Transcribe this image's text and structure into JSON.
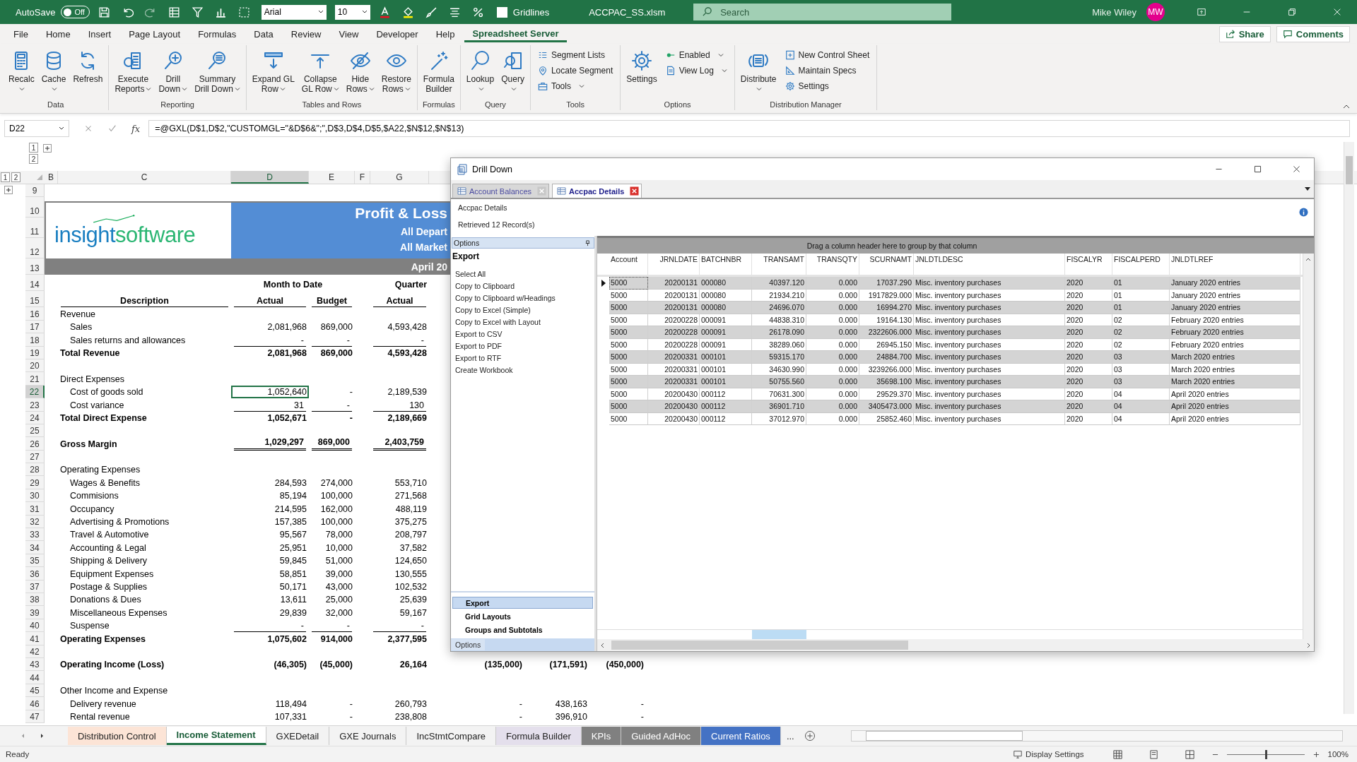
{
  "title_bar": {
    "autosave_label": "AutoSave",
    "autosave_on": false,
    "autosave_state": "Off",
    "font_name": "Arial",
    "font_size": "10",
    "gridlines_label": "Gridlines",
    "gridlines_checked": false,
    "file_name": "ACCPAC_SS.xlsm",
    "search_placeholder": "Search",
    "user_name": "Mike Wiley",
    "user_initials": "MW"
  },
  "ribbon_tabs": [
    {
      "label": "File",
      "selected": false
    },
    {
      "label": "Home",
      "selected": false
    },
    {
      "label": "Insert",
      "selected": false
    },
    {
      "label": "Page Layout",
      "selected": false
    },
    {
      "label": "Formulas",
      "selected": false
    },
    {
      "label": "Data",
      "selected": false
    },
    {
      "label": "Review",
      "selected": false
    },
    {
      "label": "View",
      "selected": false
    },
    {
      "label": "Developer",
      "selected": false
    },
    {
      "label": "Help",
      "selected": false
    },
    {
      "label": "Spreadsheet Server",
      "selected": true
    }
  ],
  "share_button": "Share",
  "comments_button": "Comments",
  "ribbon_groups": [
    {
      "label": "Data",
      "items": [
        {
          "kind": "large",
          "lines": [
            "Recalc"
          ],
          "dropdown": true
        },
        {
          "kind": "large",
          "lines": [
            "Cache"
          ],
          "dropdown": true
        },
        {
          "kind": "large",
          "lines": [
            "Refresh"
          ],
          "dropdown": false
        }
      ]
    },
    {
      "label": "Reporting",
      "items": [
        {
          "kind": "large",
          "lines": [
            "Execute",
            "Reports"
          ],
          "dropdown": true
        },
        {
          "kind": "large",
          "lines": [
            "Drill",
            "Down"
          ],
          "dropdown": true
        },
        {
          "kind": "large",
          "lines": [
            "Summary",
            "Drill Down"
          ],
          "dropdown": true
        }
      ]
    },
    {
      "label": "Tables and Rows",
      "items": [
        {
          "kind": "large",
          "lines": [
            "Expand GL",
            "Row"
          ],
          "dropdown": true
        },
        {
          "kind": "large",
          "lines": [
            "Collapse",
            "GL Row"
          ],
          "dropdown": true
        },
        {
          "kind": "large",
          "lines": [
            "Hide",
            "Rows"
          ],
          "dropdown": true
        },
        {
          "kind": "large",
          "lines": [
            "Restore",
            "Rows"
          ],
          "dropdown": true
        }
      ]
    },
    {
      "label": "Formulas",
      "items": [
        {
          "kind": "large",
          "lines": [
            "Formula",
            "Builder"
          ],
          "dropdown": false
        }
      ]
    },
    {
      "label": "Query",
      "items": [
        {
          "kind": "large",
          "lines": [
            "Lookup"
          ],
          "dropdown": true
        },
        {
          "kind": "large",
          "lines": [
            "Query"
          ],
          "dropdown": true
        }
      ]
    },
    {
      "label": "Tools",
      "items": [
        {
          "kind": "small",
          "label": "Segment Lists",
          "dropdown": false
        },
        {
          "kind": "small",
          "label": "Locate Segment",
          "dropdown": false
        },
        {
          "kind": "small",
          "label": "Tools",
          "dropdown": true
        }
      ]
    },
    {
      "label": "Options",
      "items": [
        {
          "kind": "large",
          "lines": [
            "Settings"
          ],
          "dropdown": false
        },
        {
          "kind": "small",
          "label": "Enabled",
          "dropdown": true
        },
        {
          "kind": "small",
          "label": "View Log",
          "dropdown": true
        }
      ]
    },
    {
      "label": "Distribution Manager",
      "items": [
        {
          "kind": "large",
          "lines": [
            "Distribute"
          ],
          "dropdown": true
        },
        {
          "kind": "small",
          "label": "New Control Sheet",
          "dropdown": false
        },
        {
          "kind": "small",
          "label": "Maintain Specs",
          "dropdown": false
        },
        {
          "kind": "small",
          "label": "Settings",
          "dropdown": false
        }
      ]
    }
  ],
  "formula_bar": {
    "name_box": "D22",
    "fx": "fx",
    "formula": "=@GXL(D$1,D$2,\"CUSTOMGL=\"&D$6&\";\",D$3,D$4,D$5,$A22,$N$12,$N$13)"
  },
  "sheet": {
    "column_levels": [
      "1",
      "2"
    ],
    "row_levels": [
      "1",
      "2"
    ],
    "columns": [
      {
        "label": "B",
        "selected": false
      },
      {
        "label": "C",
        "selected": false
      },
      {
        "label": "D",
        "selected": true
      },
      {
        "label": "E",
        "selected": false
      },
      {
        "label": "F",
        "selected": false
      },
      {
        "label": "G",
        "selected": false
      }
    ],
    "banner": {
      "logo": [
        "insight",
        "software"
      ],
      "title": "Profit & Loss",
      "lines": [
        "All Depart",
        "All Market"
      ],
      "bar": "April 20"
    },
    "rows": [
      {
        "n": "9",
        "kind": "blank",
        "selected": false
      },
      {
        "n": "10",
        "kind": "banner",
        "selected": false
      },
      {
        "n": "11",
        "kind": "banner",
        "selected": false
      },
      {
        "n": "12",
        "kind": "banner",
        "selected": false
      },
      {
        "n": "13",
        "kind": "banner_bar",
        "selected": false
      },
      {
        "n": "14",
        "kind": "group",
        "d": "Month to Date",
        "g": "Quarter",
        "selected": false
      },
      {
        "n": "15",
        "kind": "header",
        "c": "Description",
        "d": "Actual",
        "e": "Budget",
        "g": "Actual",
        "selected": false
      },
      {
        "n": "16",
        "kind": "label",
        "c": "Revenue",
        "selected": false
      },
      {
        "n": "17",
        "kind": "item",
        "c": "Sales",
        "d": "2,081,968",
        "e": "869,000",
        "g": "4,593,428",
        "selected": false
      },
      {
        "n": "18",
        "kind": "item",
        "c": "Sales returns and allowances",
        "d": "-",
        "e": "-",
        "g": "-",
        "underline": true,
        "selected": false
      },
      {
        "n": "19",
        "kind": "total",
        "c": "Total Revenue",
        "d": "2,081,968",
        "e": "869,000",
        "g": "4,593,428",
        "selected": false
      },
      {
        "n": "20",
        "kind": "blank",
        "selected": false
      },
      {
        "n": "21",
        "kind": "label",
        "c": "Direct Expenses",
        "selected": false
      },
      {
        "n": "22",
        "kind": "item",
        "c": "Cost of goods sold",
        "d": "1,052,640",
        "e": "-",
        "g": "2,189,539",
        "selected": true
      },
      {
        "n": "23",
        "kind": "item",
        "c": "Cost variance",
        "d": "31",
        "e": "-",
        "g": "130",
        "underline": true,
        "selected": false
      },
      {
        "n": "24",
        "kind": "total",
        "c": "Total Direct Expense",
        "d": "1,052,671",
        "e": "-",
        "g": "2,189,669",
        "selected": false
      },
      {
        "n": "25",
        "kind": "blank",
        "selected": false
      },
      {
        "n": "26",
        "kind": "total",
        "c": "Gross Margin",
        "d": "1,029,297",
        "e": "869,000",
        "g": "2,403,759",
        "double_underline": true,
        "selected": false
      },
      {
        "n": "27",
        "kind": "blank",
        "selected": false
      },
      {
        "n": "28",
        "kind": "label",
        "c": "Operating Expenses",
        "selected": false
      },
      {
        "n": "29",
        "kind": "item",
        "c": "Wages & Benefits",
        "d": "284,593",
        "e": "274,000",
        "g": "553,710",
        "selected": false
      },
      {
        "n": "30",
        "kind": "item",
        "c": "Commisions",
        "d": "85,194",
        "e": "100,000",
        "g": "271,568",
        "selected": false
      },
      {
        "n": "31",
        "kind": "item",
        "c": "Occupancy",
        "d": "214,595",
        "e": "162,000",
        "g": "488,119",
        "selected": false
      },
      {
        "n": "32",
        "kind": "item",
        "c": "Advertising & Promotions",
        "d": "157,385",
        "e": "100,000",
        "g": "375,275",
        "selected": false
      },
      {
        "n": "33",
        "kind": "item",
        "c": "Travel & Automotive",
        "d": "95,567",
        "e": "78,000",
        "g": "208,797",
        "selected": false
      },
      {
        "n": "34",
        "kind": "item",
        "c": "Accounting & Legal",
        "d": "25,951",
        "e": "10,000",
        "g": "37,582",
        "selected": false
      },
      {
        "n": "35",
        "kind": "item",
        "c": "Shipping & Delivery",
        "d": "59,845",
        "e": "51,000",
        "g": "124,650",
        "selected": false
      },
      {
        "n": "36",
        "kind": "item",
        "c": "Equipment Expenses",
        "d": "58,851",
        "e": "39,000",
        "g": "130,555",
        "selected": false
      },
      {
        "n": "37",
        "kind": "item",
        "c": "Postage & Supplies",
        "d": "50,171",
        "e": "43,000",
        "g": "102,532",
        "selected": false
      },
      {
        "n": "38",
        "kind": "item",
        "c": "Donations & Dues",
        "d": "13,611",
        "e": "25,000",
        "g": "25,639",
        "selected": false
      },
      {
        "n": "39",
        "kind": "item",
        "c": "Miscellaneous Expenses",
        "d": "29,839",
        "e": "32,000",
        "g": "59,167",
        "selected": false
      },
      {
        "n": "40",
        "kind": "item",
        "c": "Suspense",
        "d": "-",
        "e": "-",
        "g": "-",
        "underline": true,
        "selected": false
      },
      {
        "n": "41",
        "kind": "total",
        "c": "Operating Expenses",
        "d": "1,075,602",
        "e": "914,000",
        "g": "2,377,595",
        "selected": false
      },
      {
        "n": "42",
        "kind": "blank",
        "selected": false
      },
      {
        "n": "43",
        "kind": "total",
        "c": "Operating Income (Loss)",
        "d": "(46,305)",
        "e": "(45,000)",
        "g": "26,164",
        "h": "(135,000)",
        "i": "(171,591)",
        "j": "(450,000)",
        "selected": false
      },
      {
        "n": "44",
        "kind": "blank",
        "selected": false
      },
      {
        "n": "45",
        "kind": "label",
        "c": "Other Income and Expense",
        "selected": false
      },
      {
        "n": "46",
        "kind": "item",
        "c": "Delivery revenue",
        "d": "118,494",
        "e": "-",
        "g": "260,793",
        "h": "-",
        "i": "438,163",
        "j": "-",
        "selected": false
      },
      {
        "n": "47",
        "kind": "item",
        "c": "Rental revenue",
        "d": "107,331",
        "e": "-",
        "g": "238,808",
        "h": "-",
        "i": "396,910",
        "j": "-",
        "selected": false
      }
    ]
  },
  "drill_down": {
    "title": "Drill Down",
    "tabs": [
      {
        "label": "Account Balances",
        "selected": false
      },
      {
        "label": "Accpac Details",
        "selected": true
      }
    ],
    "heading": "Accpac Details",
    "status": "Retrieved 12 Record(s)",
    "options": {
      "header": "Options",
      "section": "Export",
      "items": [
        "Select All",
        "Copy to Clipboard",
        "Copy to Clipboard w/Headings",
        "Copy to Excel (Simple)",
        "Copy to Excel with Layout",
        "Export to CSV",
        "Export to PDF",
        "Export to RTF",
        "Create Workbook"
      ],
      "nav": [
        {
          "label": "Export",
          "selected": true
        },
        {
          "label": "Grid Layouts",
          "selected": false
        },
        {
          "label": "Groups and Subtotals",
          "selected": false
        }
      ],
      "footer": "Options"
    },
    "grid": {
      "group_hint": "Drag a column header here to group by that column",
      "columns": [
        "Account",
        "JRNLDATE",
        "BATCHNBR",
        "TRANSAMT",
        "TRANSQTY",
        "SCURNAMT",
        "JNLDTLDESC",
        "FISCALYR",
        "FISCALPERD",
        "JNLDTLREF"
      ],
      "rows": [
        {
          "current": true,
          "cells": [
            "5000",
            "20200131",
            "000080",
            "40397.120",
            "0.000",
            "17037.290",
            "Misc. inventory purchases",
            "2020",
            "01",
            "January 2020 entries"
          ]
        },
        {
          "current": false,
          "cells": [
            "5000",
            "20200131",
            "000080",
            "21934.210",
            "0.000",
            "1917829.000",
            "Misc. inventory purchases",
            "2020",
            "01",
            "January 2020 entries"
          ]
        },
        {
          "current": false,
          "cells": [
            "5000",
            "20200131",
            "000080",
            "24696.070",
            "0.000",
            "16994.270",
            "Misc. inventory purchases",
            "2020",
            "01",
            "January 2020 entries"
          ]
        },
        {
          "current": false,
          "cells": [
            "5000",
            "20200228",
            "000091",
            "44838.310",
            "0.000",
            "19164.130",
            "Misc. inventory purchases",
            "2020",
            "02",
            "February 2020 entries"
          ]
        },
        {
          "current": false,
          "cells": [
            "5000",
            "20200228",
            "000091",
            "26178.090",
            "0.000",
            "2322606.000",
            "Misc. inventory purchases",
            "2020",
            "02",
            "February 2020 entries"
          ]
        },
        {
          "current": false,
          "cells": [
            "5000",
            "20200228",
            "000091",
            "38289.060",
            "0.000",
            "26945.150",
            "Misc. inventory purchases",
            "2020",
            "02",
            "February 2020 entries"
          ]
        },
        {
          "current": false,
          "cells": [
            "5000",
            "20200331",
            "000101",
            "59315.170",
            "0.000",
            "24884.700",
            "Misc. inventory purchases",
            "2020",
            "03",
            "March 2020 entries"
          ]
        },
        {
          "current": false,
          "cells": [
            "5000",
            "20200331",
            "000101",
            "34630.990",
            "0.000",
            "3239266.000",
            "Misc. inventory purchases",
            "2020",
            "03",
            "March 2020 entries"
          ]
        },
        {
          "current": false,
          "cells": [
            "5000",
            "20200331",
            "000101",
            "50755.560",
            "0.000",
            "35698.100",
            "Misc. inventory purchases",
            "2020",
            "03",
            "March 2020 entries"
          ]
        },
        {
          "current": false,
          "cells": [
            "5000",
            "20200430",
            "000112",
            "70631.300",
            "0.000",
            "29529.370",
            "Misc. inventory purchases",
            "2020",
            "04",
            "April 2020 entries"
          ]
        },
        {
          "current": false,
          "cells": [
            "5000",
            "20200430",
            "000112",
            "36901.710",
            "0.000",
            "3405473.000",
            "Misc. inventory purchases",
            "2020",
            "04",
            "April 2020 entries"
          ]
        },
        {
          "current": false,
          "cells": [
            "5000",
            "20200430",
            "000112",
            "37012.970",
            "0.000",
            "25852.460",
            "Misc. inventory purchases",
            "2020",
            "04",
            "April 2020 entries"
          ]
        }
      ]
    }
  },
  "sheet_tabs": [
    {
      "label": "Distribution Control",
      "selected": false,
      "color": "#fce4d6"
    },
    {
      "label": "Income Statement",
      "selected": true
    },
    {
      "label": "GXEDetail",
      "selected": false
    },
    {
      "label": "GXE Journals",
      "selected": false
    },
    {
      "label": "IncStmtCompare",
      "selected": false
    },
    {
      "label": "Formula Builder",
      "selected": false,
      "color": "#e4dfec"
    },
    {
      "label": "KPIs",
      "selected": false,
      "color": "#808080"
    },
    {
      "label": "Guided AdHoc",
      "selected": false,
      "color": "#808080"
    },
    {
      "label": "Current Ratios",
      "selected": false,
      "color": "#4472c4"
    }
  ],
  "more_tabs": "...",
  "status_bar": {
    "ready": "Ready",
    "display_settings": "Display Settings",
    "zoom": {
      "level": 0.5
    },
    "zoom_label": "100%"
  }
}
